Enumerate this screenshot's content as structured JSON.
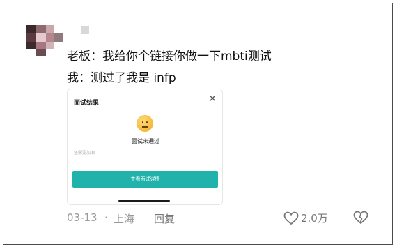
{
  "post": {
    "line1": "老板：我给你个链接你做一下mbti测试",
    "line2": "我：测过了我是 infp"
  },
  "card": {
    "title": "面试结果",
    "result": "面试未通过",
    "hint": "还需要加油",
    "button_label": "查看面试详情"
  },
  "meta": {
    "date": "03-13",
    "separator": "·",
    "location": "上海",
    "reply_label": "回复",
    "like_count": "2.0万"
  },
  "icons": {
    "close": "close-icon",
    "emoji": "sad-face-emoji-icon",
    "like": "heart-icon",
    "dislike": "broken-heart-icon"
  }
}
